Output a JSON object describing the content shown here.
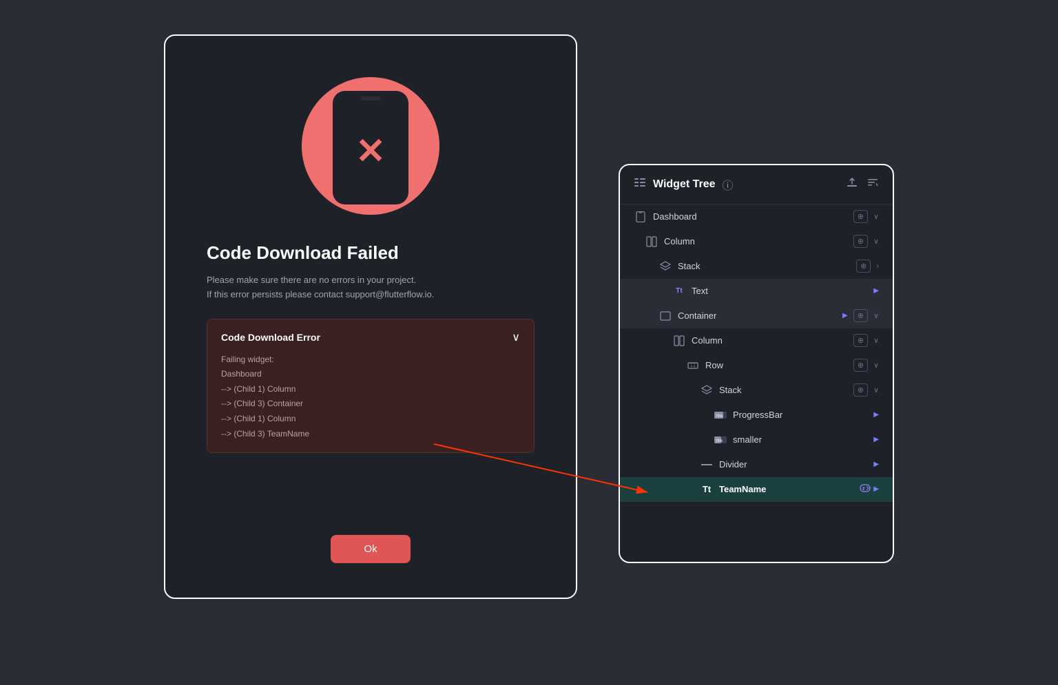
{
  "background": {
    "color": "#2a2d35"
  },
  "error_dialog": {
    "title": "Code Download Failed",
    "description_line1": "Please make sure there are no errors in your project.",
    "description_line2": "If this error persists please contact support@flutterflow.io.",
    "error_box": {
      "title": "Code Download Error",
      "content_lines": [
        "Failing widget:",
        "Dashboard",
        "--> (Child 1) Column",
        "--> (Child 3) Container",
        "--> (Child 1) Column",
        "--> (Child 3) TeamName"
      ]
    },
    "ok_button_label": "Ok"
  },
  "widget_tree": {
    "title": "Widget Tree",
    "items": [
      {
        "label": "Dashboard",
        "indent": 0,
        "icon": "phone-icon"
      },
      {
        "label": "Column",
        "indent": 1,
        "icon": "column-icon"
      },
      {
        "label": "Stack",
        "indent": 2,
        "icon": "stack-icon"
      },
      {
        "label": "Text",
        "indent": 3,
        "icon": "text-icon",
        "has_play": true
      },
      {
        "label": "Container",
        "indent": 2,
        "icon": "container-icon",
        "has_play": true
      },
      {
        "label": "Column",
        "indent": 3,
        "icon": "column-icon"
      },
      {
        "label": "Row",
        "indent": 4,
        "icon": "row-icon"
      },
      {
        "label": "Stack",
        "indent": 5,
        "icon": "stack-icon"
      },
      {
        "label": "ProgressBar",
        "indent": 6,
        "icon": "progressbar-icon",
        "has_play": true
      },
      {
        "label": "smaller",
        "indent": 6,
        "icon": "smaller-icon",
        "has_play": true
      },
      {
        "label": "Divider",
        "indent": 5,
        "icon": "divider-icon",
        "has_play": true
      },
      {
        "label": "TeamName",
        "indent": 5,
        "icon": "text-tt-icon",
        "selected": true,
        "has_play": true
      }
    ]
  }
}
